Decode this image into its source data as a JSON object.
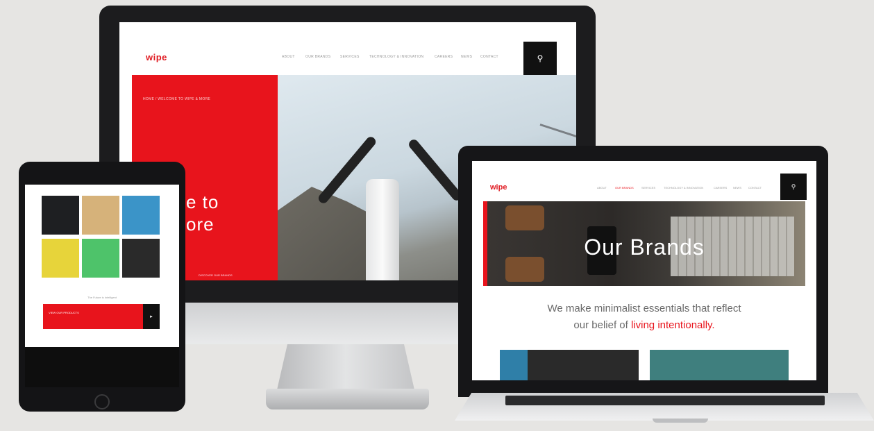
{
  "desktop": {
    "logo": "wipe",
    "nav_links": [
      "ABOUT",
      "OUR BRANDS",
      "SERVICES",
      "TECHNOLOGY & INNOVATION",
      "CAREERS",
      "NEWS",
      "CONTACT"
    ],
    "breadcrumb": "HOME / WELCOME TO WIPE & MORE",
    "hero_line1": "e to",
    "hero_line2": "ore",
    "hero_footer": "DISCOVER OUR BRANDS"
  },
  "tablet": {
    "caption": "The Future is Intelligent",
    "cta_label": "VIEW OUR PRODUCTS",
    "tile_colors": [
      "#1e1f22",
      "#d6b27a",
      "#3b94c8",
      "#e7d43a",
      "#4ec36a",
      "#2a2a2a"
    ]
  },
  "laptop": {
    "logo": "wipe",
    "nav_links": [
      "ABOUT",
      "OUR BRANDS",
      "SERVICES",
      "TECHNOLOGY & INNOVATION",
      "CAREERS",
      "NEWS",
      "CONTACT"
    ],
    "hero_title": "Our Brands",
    "tagline_line1": "We make minimalist essentials that reflect",
    "tagline_line2_prefix": "our belief of ",
    "tagline_line2_accent": "living intentionally."
  },
  "colors": {
    "brand_red": "#e8141c",
    "dark": "#111111",
    "background": "#e6e5e3"
  },
  "icons": {
    "search": "search-icon",
    "arrow": "arrow-right-icon"
  }
}
